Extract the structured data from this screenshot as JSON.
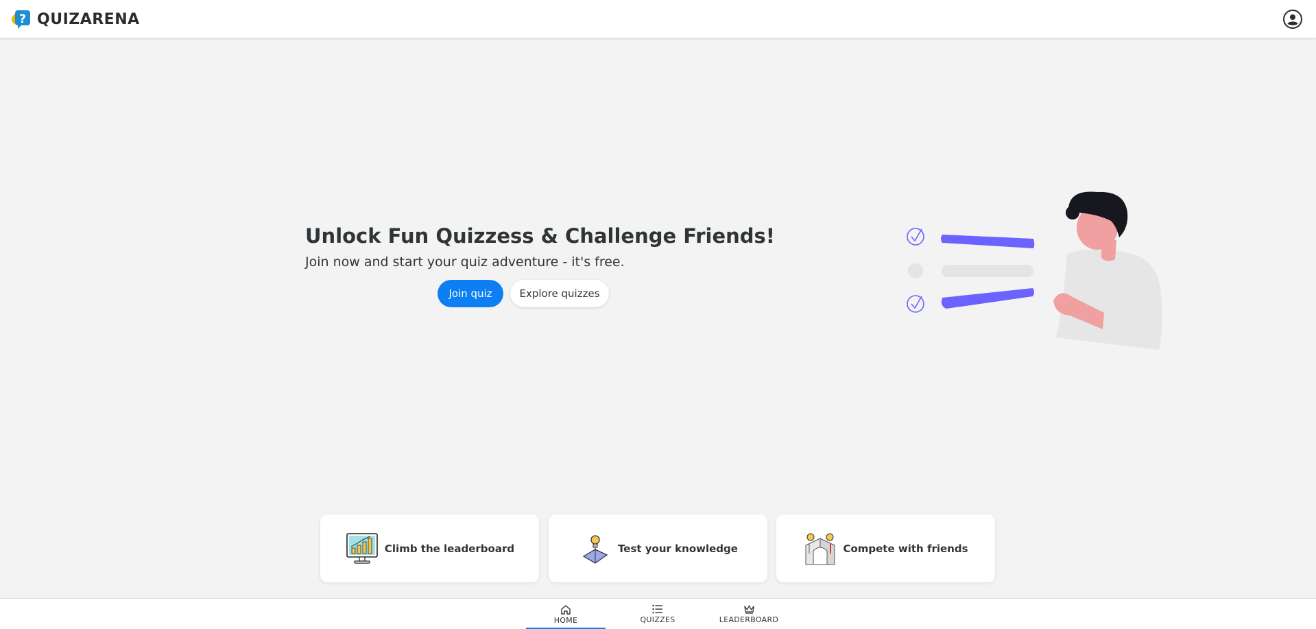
{
  "header": {
    "brand_name": "QUIZARENA",
    "logo_icon": "question-mark-speech-bubble-icon",
    "user_icon": "user-account-icon"
  },
  "hero": {
    "title": "Unlock Fun Quizzess & Challenge Friends!",
    "subtitle": "Join now and start your quiz adventure - it's free.",
    "primary_button": "Join quiz",
    "secondary_button": "Explore quizzes",
    "illustration": "person-checklist-illustration"
  },
  "features": [
    {
      "label": "Climb the leaderboard",
      "icon": "leaderboard-monitor-icon"
    },
    {
      "label": "Test your knowledge",
      "icon": "lightbulb-book-icon"
    },
    {
      "label": "Compete with friends",
      "icon": "people-compete-icon"
    }
  ],
  "bottom_nav": {
    "items": [
      {
        "label": "HOME",
        "icon": "home-icon",
        "active": true
      },
      {
        "label": "QUIZZES",
        "icon": "list-icon",
        "active": false
      },
      {
        "label": "LEADERBOARD",
        "icon": "crown-icon",
        "active": false
      }
    ]
  },
  "colors": {
    "accent": "#0d7ff2",
    "background": "#f3f3f3",
    "illustration_purple": "#6c63ff",
    "skin": "#f0a0a0"
  }
}
